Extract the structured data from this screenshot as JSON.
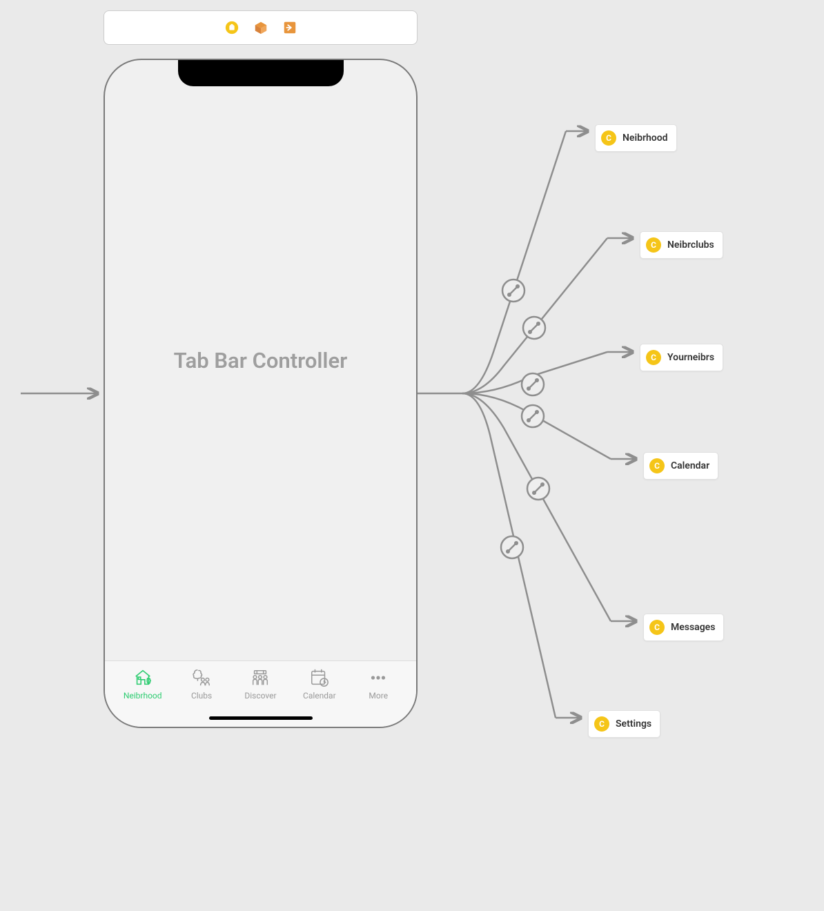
{
  "toolbar": {
    "icon_a": "storyboard-badge",
    "icon_b": "scene-box",
    "icon_c": "exit-box"
  },
  "screen": {
    "title": "Tab Bar Controller"
  },
  "tabs": [
    {
      "label": "Neibrhood",
      "icon_name": "house-icon",
      "selected": true
    },
    {
      "label": "Clubs",
      "icon_name": "tree-people-icon",
      "selected": false
    },
    {
      "label": "Discover",
      "icon_name": "people-group-icon",
      "selected": false
    },
    {
      "label": "Calendar",
      "icon_name": "calendar-clock-icon",
      "selected": false
    },
    {
      "label": "More",
      "icon_name": "ellipsis-icon",
      "selected": false
    }
  ],
  "destinations": [
    {
      "label": "Neibrhood"
    },
    {
      "label": "Neibrclubs"
    },
    {
      "label": "Yourneibrs"
    },
    {
      "label": "Calendar"
    },
    {
      "label": "Messages"
    },
    {
      "label": "Settings"
    }
  ]
}
